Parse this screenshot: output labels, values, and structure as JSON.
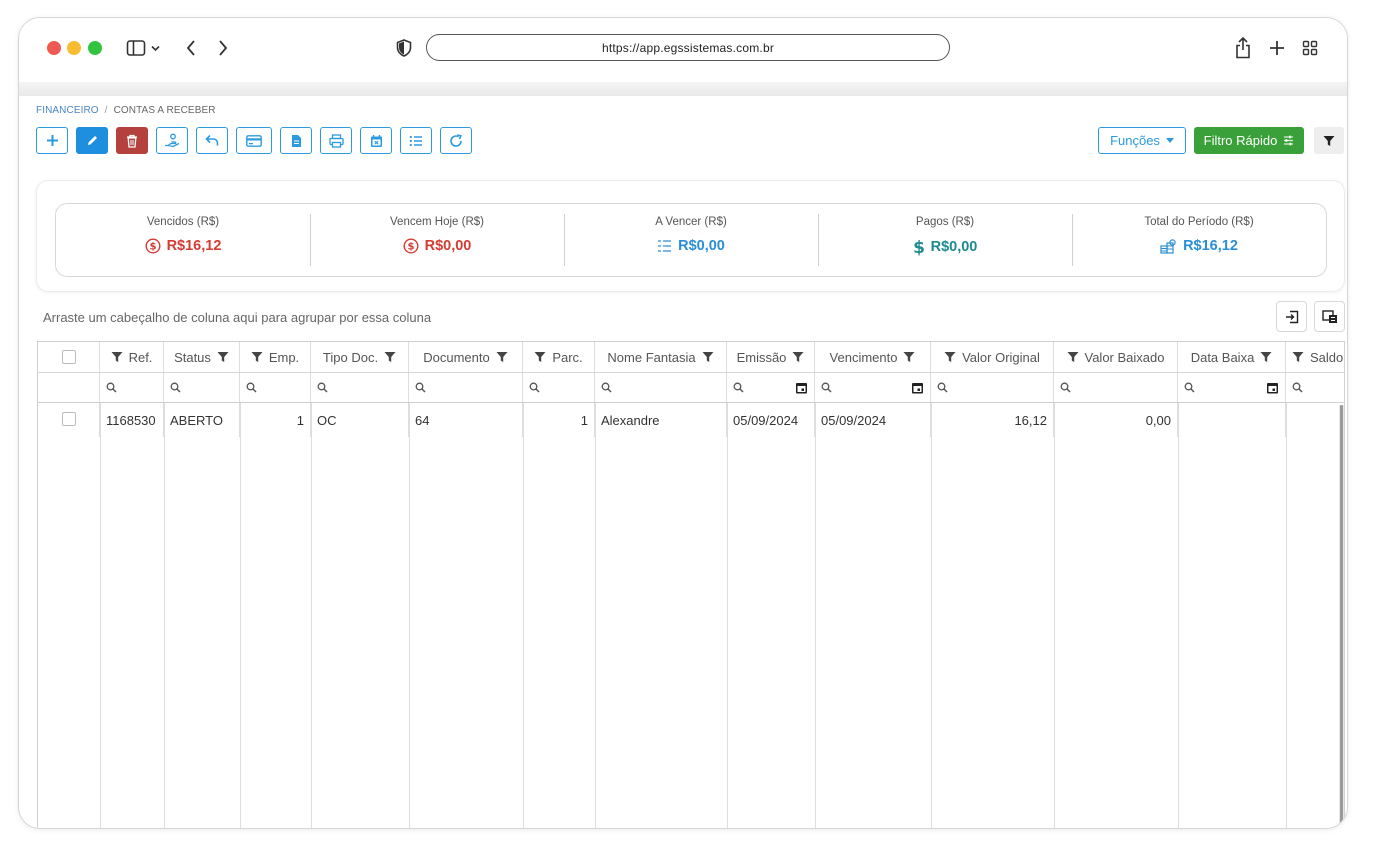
{
  "browser": {
    "url": "https://app.egssistemas.com.br"
  },
  "breadcrumb": {
    "parent": "FINANCEIRO",
    "separator": "/",
    "current": "CONTAS A RECEBER"
  },
  "toolbar": {
    "funcoes_label": "Funções",
    "filtro_rapido_label": "Filtro Rápido"
  },
  "summary": [
    {
      "label": "Vencidos (R$)",
      "value": "R$16,12",
      "color": "#d43b33",
      "icon": "dollar-circle-icon"
    },
    {
      "label": "Vencem Hoje (R$)",
      "value": "R$0,00",
      "color": "#d43b33",
      "icon": "dollar-circle-icon"
    },
    {
      "label": "A Vencer (R$)",
      "value": "R$0,00",
      "color": "#2a8fd6",
      "icon": "list-icon"
    },
    {
      "label": "Pagos (R$)",
      "value": "R$0,00",
      "color": "#1f8a8f",
      "icon": "dollar-icon"
    },
    {
      "label": "Total do Período (R$)",
      "value": "R$16,12",
      "color": "#2a8fd6",
      "icon": "coins-icon"
    }
  ],
  "grid": {
    "group_hint": "Arraste um cabeçalho de coluna aqui para agrupar por essa coluna",
    "columns": [
      "Ref.",
      "Status",
      "Emp.",
      "Tipo Doc.",
      "Documento",
      "Parc.",
      "Nome Fantasia",
      "Emissão",
      "Vencimento",
      "Valor Original",
      "Valor Baixado",
      "Data Baixa",
      "Saldo"
    ],
    "rows": [
      {
        "ref": "1168530",
        "status": "ABERTO",
        "emp": "1",
        "tipo_doc": "OC",
        "documento": "64",
        "parc": "1",
        "nome_fantasia": "Alexandre",
        "emissao": "05/09/2024",
        "vencimento": "05/09/2024",
        "valor_original": "16,12",
        "valor_baixado": "0,00",
        "data_baixa": "",
        "saldo": ""
      }
    ]
  }
}
